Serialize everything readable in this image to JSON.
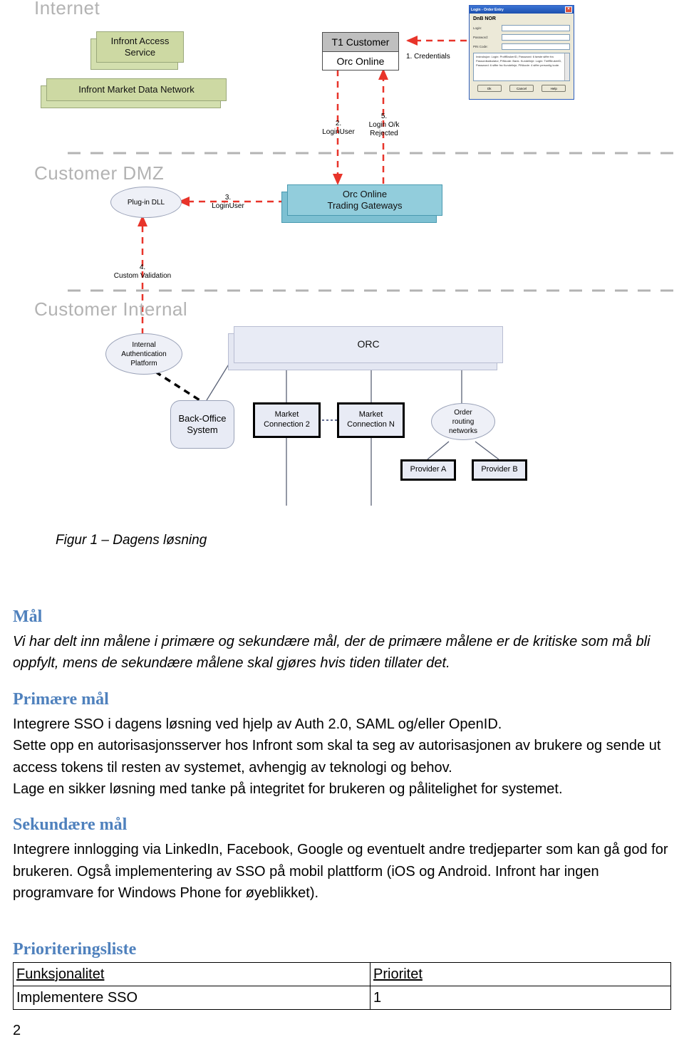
{
  "figure": {
    "zones": [
      {
        "name": "Internet",
        "label": "Internet"
      },
      {
        "name": "Customer DMZ",
        "label": "Customer DMZ"
      },
      {
        "name": "Customer Internal",
        "label": "Customer Internal"
      }
    ],
    "nodes": {
      "infront_access_service": "Infront Access\nService",
      "infront_market_data_network": "Infront Market Data Network",
      "t1_customer": "T1 Customer",
      "orc_online": "Orc Online",
      "orc_online_trading_gateways": "Orc Online\nTrading Gateways",
      "plugin_dll": "Plug-in DLL",
      "internal_auth_platform": "Internal\nAuthentication\nPlatform",
      "back_office_system": "Back-Office\nSystem",
      "orc": "ORC",
      "market_connection_2": "Market\nConnection 2",
      "market_connection_n": "Market\nConnection N",
      "order_routing_networks": "Order\nrouting\nnetworks",
      "provider_a": "Provider A",
      "provider_b": "Provider B"
    },
    "flow_labels": {
      "step1": "1. Credentials",
      "step2": "2.\nLoginUser",
      "step3": "3.\nLoginUser",
      "step4": "4.\nCustom Validation",
      "step5": "5.\nLogin O/k\nRejected"
    },
    "login_dialog": {
      "title": "Login - Order Entry",
      "close_label": "×",
      "bank": "DnB NOR",
      "fields": [
        {
          "label": "Login:",
          "value": ""
        },
        {
          "label": "Password:",
          "value": ""
        },
        {
          "label": "PIN Code:",
          "value": ""
        }
      ],
      "info_text": "Instruksjon: Login: ProffBrukerID, Password: 6 første siffer fra Passordkalkulator, PINkode: Bank. Kundelinje: Login: TreffBrukerID, Password: 6 siffer fra Kundelinje, PINkode: 4 siffer personlig kode.",
      "buttons": [
        "Ok",
        "Cancel",
        "Help"
      ]
    },
    "colors": {
      "green_fill": "#cdd9a3",
      "blue_fill": "#92cddc",
      "lavender_fill": "#e8ebf5",
      "gray_header": "#bfbfbf",
      "arrow_red": "#e8342a",
      "zone_label": "#b3b3b3"
    }
  },
  "document": {
    "figure_caption": "Figur 1 – Dagens løsning",
    "sections": [
      {
        "heading": "Mål",
        "paragraphs": [
          "Vi har delt inn målene i primære og sekundære mål, der de primære målene er de kritiske som må bli oppfylt, mens de sekundære målene skal gjøres hvis tiden tillater det."
        ]
      },
      {
        "heading": "Primære mål",
        "paragraphs": [
          "Integrere SSO i dagens løsning  ved hjelp av Auth 2.0, SAML og/eller OpenID.",
          "Sette opp en autorisasjonsserver hos Infront som skal ta seg av autorisasjonen av brukere og sende ut access tokens til resten av systemet,  avhengig av teknologi og behov.",
          "Lage en sikker løsning med tanke på integritet for brukeren og pålitelighet for systemet."
        ]
      },
      {
        "heading": "Sekundære mål",
        "paragraphs": [
          "Integrere innlogging via LinkedIn, Facebook, Google og eventuelt andre tredjeparter som kan gå god for brukeren. Også implementering av SSO på mobil plattform (iOS og Android. Infront har ingen programvare for Windows Phone for øyeblikket)."
        ]
      }
    ],
    "priority_section": {
      "heading": "Prioriteringsliste",
      "table": {
        "columns": [
          "Funksjonalitet",
          "Prioritet"
        ],
        "rows": [
          [
            "Implementere SSO",
            "1"
          ]
        ]
      }
    },
    "page_number": "2",
    "heading_color": "#4f81bd"
  }
}
